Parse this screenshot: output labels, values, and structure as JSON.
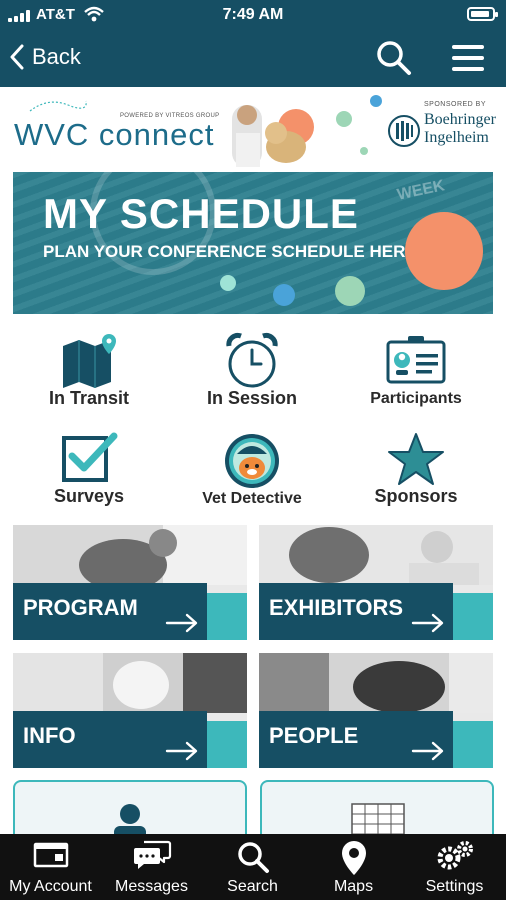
{
  "status": {
    "carrier": "AT&T",
    "time": "7:49 AM"
  },
  "nav": {
    "back_label": "Back"
  },
  "brand": {
    "logo": "WVC connect",
    "powered_by": "POWERED BY VITREOS GROUP",
    "sponsored_by": "SPONSORED BY",
    "sponsor_name_line1": "Boehringer",
    "sponsor_name_line2": "Ingelheim"
  },
  "hero": {
    "title": "MY SCHEDULE",
    "subtitle": "PLAN YOUR CONFERENCE SCHEDULE HERE",
    "watermark": "WEEK"
  },
  "icon_grid": [
    {
      "label": "In Transit",
      "icon": "map-pin-icon"
    },
    {
      "label": "In Session",
      "icon": "alarm-clock-icon"
    },
    {
      "label": "Participants",
      "icon": "id-badge-icon"
    },
    {
      "label": "Surveys",
      "icon": "checkbox-icon"
    },
    {
      "label": "Vet Detective",
      "icon": "detective-avatar-icon"
    },
    {
      "label": "Sponsors",
      "icon": "star-icon"
    }
  ],
  "tiles": [
    {
      "label": "PROGRAM"
    },
    {
      "label": "EXHIBITORS"
    },
    {
      "label": "INFO"
    },
    {
      "label": "PEOPLE"
    }
  ],
  "tabs": [
    {
      "label": "My Account",
      "icon": "account-icon"
    },
    {
      "label": "Messages",
      "icon": "messages-icon"
    },
    {
      "label": "Search",
      "icon": "search-icon"
    },
    {
      "label": "Maps",
      "icon": "map-pin-icon"
    },
    {
      "label": "Settings",
      "icon": "gears-icon"
    }
  ],
  "colors": {
    "primary": "#164f64",
    "accent": "#3db8bb",
    "hero": "#2d7f8e",
    "coral": "#f4916a"
  }
}
